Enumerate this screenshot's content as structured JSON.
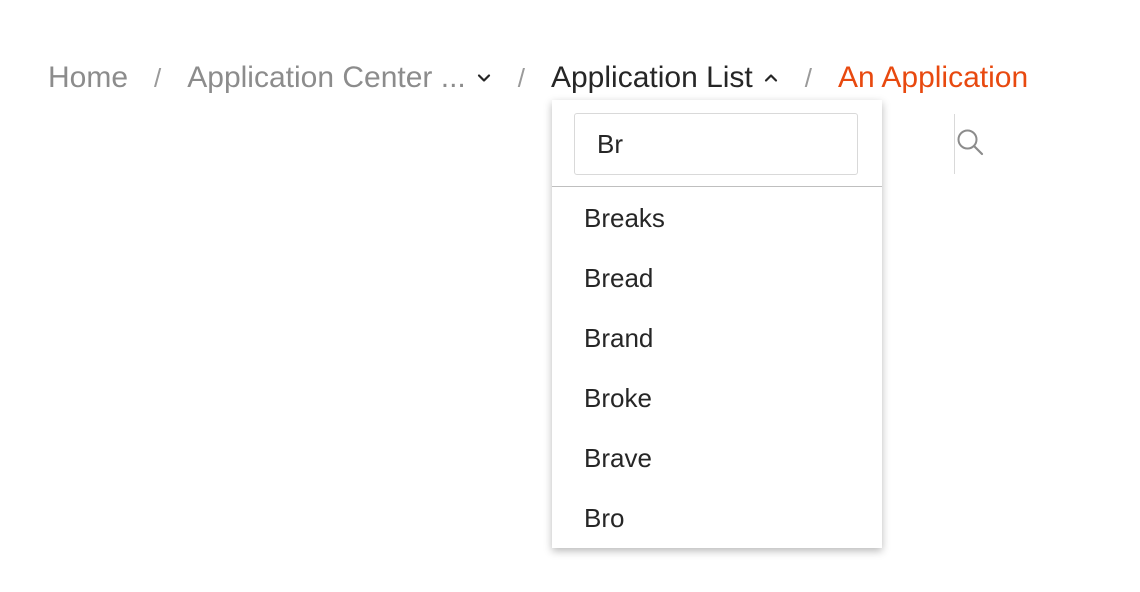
{
  "breadcrumb": {
    "items": [
      {
        "label": "Home"
      },
      {
        "label": "Application Center ...",
        "icon": "chevron-down-icon"
      },
      {
        "label": "Application List",
        "icon": "chevron-up-icon"
      },
      {
        "label": "An Application"
      }
    ],
    "separator": "/"
  },
  "dropdown": {
    "search_value": "Br",
    "search_icon": "search-icon",
    "options": [
      "Breaks",
      "Bread",
      "Brand",
      "Broke",
      "Brave",
      "Bro"
    ]
  },
  "colors": {
    "active": "#e8490f",
    "muted": "#8c8c8c",
    "text": "#262626"
  }
}
